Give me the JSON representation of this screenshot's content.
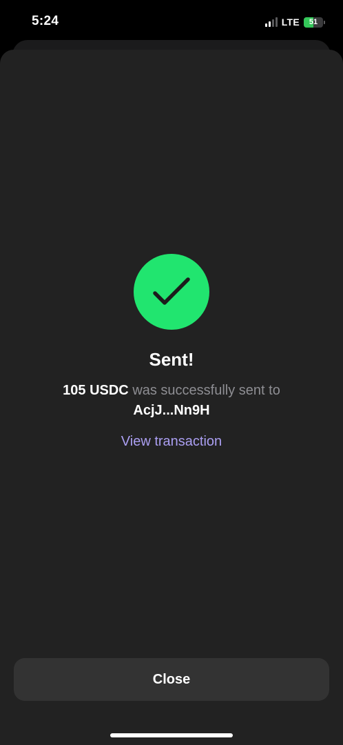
{
  "status_bar": {
    "time": "5:24",
    "network": "LTE",
    "battery": "51",
    "battery_level": 0.51,
    "signal_bars_active": 2,
    "signal_bars_total": 4
  },
  "success": {
    "icon": "checkmark-icon",
    "title": "Sent!",
    "amount": "105 USDC",
    "message_middle": "was successfully sent to",
    "recipient": "AcjJ...Nn9H",
    "link": "View transaction"
  },
  "actions": {
    "close_label": "Close"
  },
  "colors": {
    "background": "#000000",
    "sheet": "#222222",
    "success_green": "#21e56f",
    "link_purple": "#ab9ff2",
    "button": "#333333",
    "muted_text": "#8e8e93",
    "battery_green": "#34c759"
  }
}
